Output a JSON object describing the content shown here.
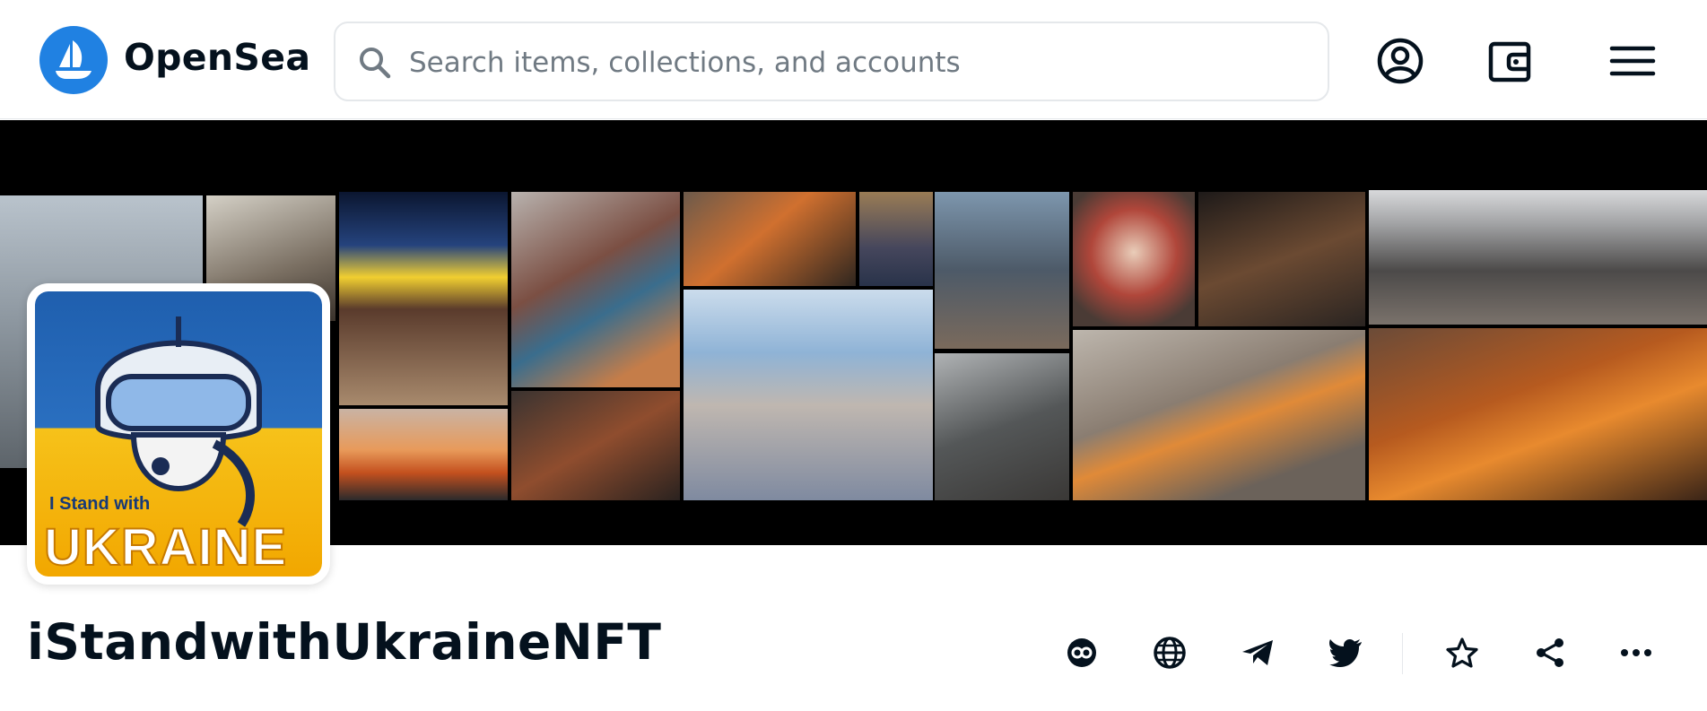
{
  "header": {
    "brand": "OpenSea",
    "search_placeholder": "Search items, collections, and accounts",
    "icons": [
      "opensea-logo-icon",
      "search-icon",
      "account-icon",
      "wallet-icon",
      "menu-icon"
    ]
  },
  "banner": {
    "description_icon": "collection-banner-image"
  },
  "collection": {
    "avatar_text_small": "I Stand with",
    "avatar_text_big": "UKRAINE",
    "name": "iStandwithUkraineNFT",
    "actions": [
      "link-icon",
      "globe-icon",
      "telegram-icon",
      "twitter-icon",
      "star-icon",
      "share-icon",
      "more-icon"
    ]
  },
  "colors": {
    "brand_blue": "#2081e2",
    "text_primary": "#04111d",
    "text_muted": "#707a83",
    "border": "#e5e8eb"
  }
}
